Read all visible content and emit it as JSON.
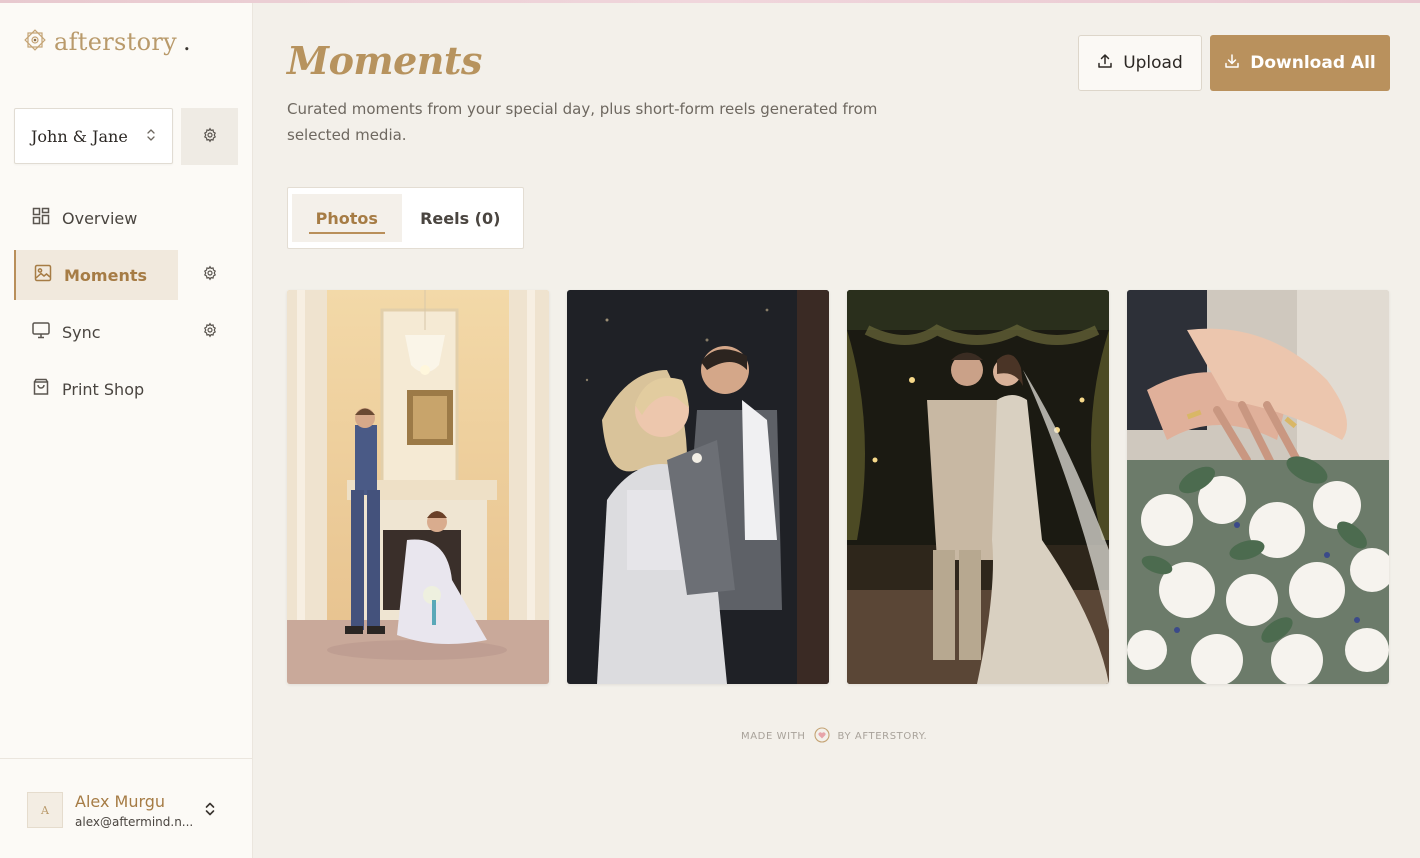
{
  "brand": {
    "name": "afterstory",
    "accent": "#b9915d"
  },
  "sidebar": {
    "project": {
      "name": "John & Jane"
    },
    "items": [
      {
        "label": "Overview",
        "icon": "grid-icon",
        "active": false
      },
      {
        "label": "Moments",
        "icon": "image-icon",
        "active": true
      },
      {
        "label": "Sync",
        "icon": "monitor-icon",
        "active": false
      },
      {
        "label": "Print Shop",
        "icon": "shopping-bag-icon",
        "active": false
      }
    ],
    "user": {
      "initial": "A",
      "name": "Alex Murgu",
      "email": "alex@aftermind.n..."
    }
  },
  "header": {
    "title": "Moments",
    "description": "Curated moments from your special day, plus short-form reels generated from selected media.",
    "upload_label": "Upload",
    "download_label": "Download All"
  },
  "tabs": [
    {
      "label": "Photos",
      "active": true
    },
    {
      "label": "Reels (0)",
      "active": false
    }
  ],
  "gallery": [
    {
      "subject": "couple-by-fireplace-photo"
    },
    {
      "subject": "couple-embrace-dark-photo"
    },
    {
      "subject": "couple-kiss-string-lights-photo"
    },
    {
      "subject": "hands-rings-bouquet-photo"
    }
  ],
  "footer": {
    "made_with": "MADE WITH",
    "by": "BY AFTERSTORY."
  }
}
